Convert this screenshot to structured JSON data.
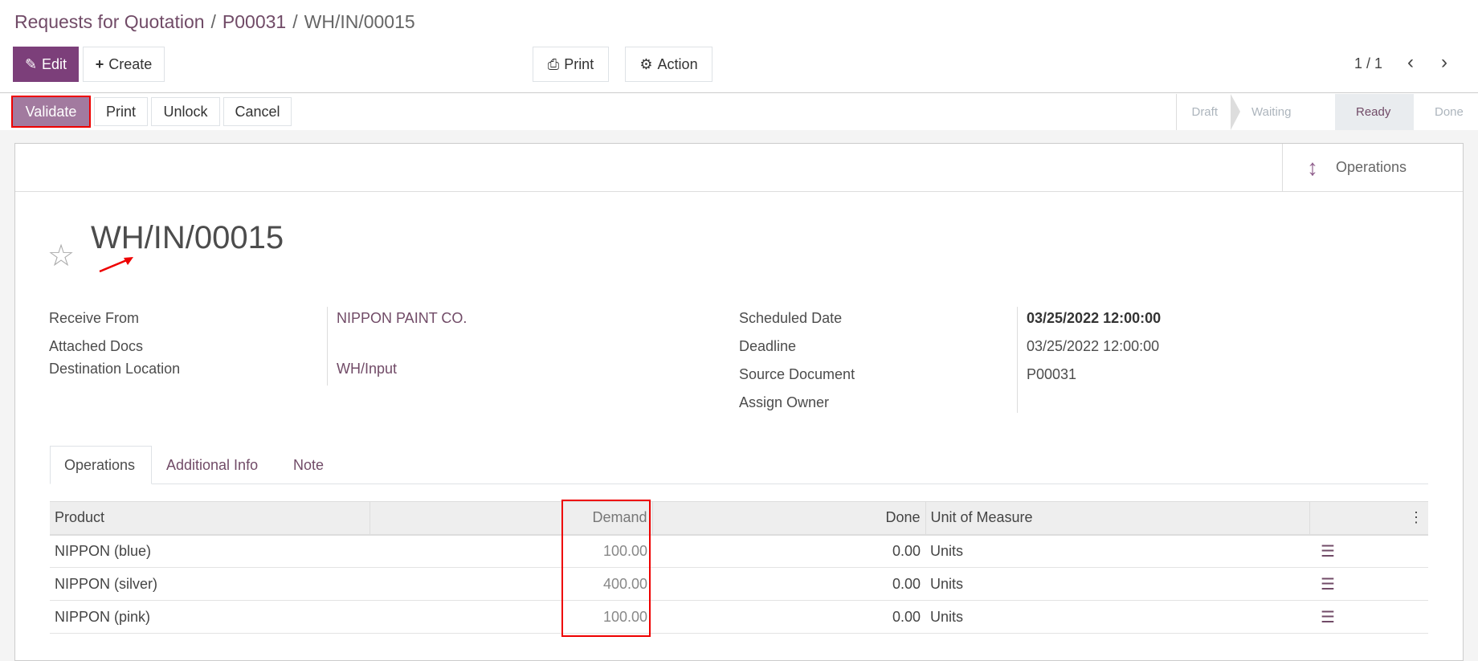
{
  "breadcrumb": [
    "Requests for Quotation",
    "P00031",
    "WH/IN/00015"
  ],
  "toolbar": {
    "edit": "Edit",
    "create": "Create",
    "print": "Print",
    "action": "Action",
    "pager": "1 / 1"
  },
  "actions": {
    "validate": "Validate",
    "print": "Print",
    "unlock": "Unlock",
    "cancel": "Cancel"
  },
  "statusbar": [
    "Draft",
    "Waiting",
    "Ready",
    "Done"
  ],
  "status_active": "Ready",
  "smart_button": "Operations",
  "title": "WH/IN/00015",
  "fields_left": [
    {
      "label": "Receive From",
      "value": "NIPPON PAINT CO."
    },
    {
      "label": "Attached Docs",
      "value": ""
    },
    {
      "label": "Destination Location",
      "value": "WH/Input"
    }
  ],
  "fields_right": [
    {
      "label": "Scheduled Date",
      "value": "03/25/2022 12:00:00"
    },
    {
      "label": "Deadline",
      "value": "03/25/2022 12:00:00"
    },
    {
      "label": "Source Document",
      "value": "P00031"
    },
    {
      "label": "Assign Owner",
      "value": ""
    }
  ],
  "tabs": [
    "Operations",
    "Additional Info",
    "Note"
  ],
  "table": {
    "headers": [
      "Product",
      "Demand",
      "Done",
      "Unit of Measure"
    ],
    "rows": [
      {
        "product": "NIPPON (blue)",
        "demand": "100.00",
        "done": "0.00",
        "uom": "Units"
      },
      {
        "product": "NIPPON (silver)",
        "demand": "400.00",
        "done": "0.00",
        "uom": "Units"
      },
      {
        "product": "NIPPON (pink)",
        "demand": "100.00",
        "done": "0.00",
        "uom": "Units"
      }
    ]
  },
  "colors": {
    "brand": "#714b67",
    "primary_button": "#7c3f7a",
    "annotation": "#e00000"
  }
}
